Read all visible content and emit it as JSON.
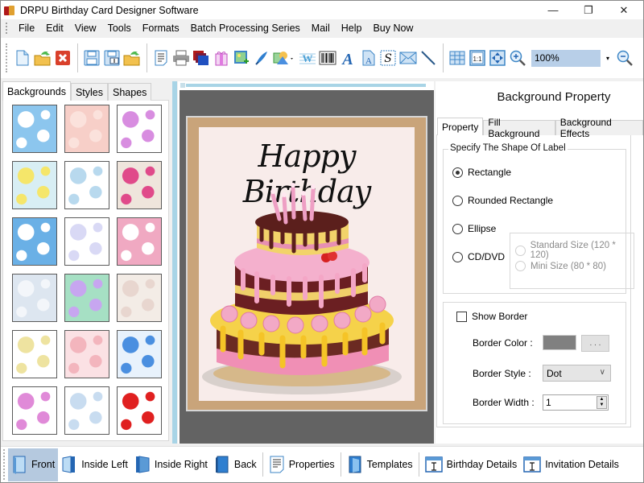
{
  "window": {
    "title": "DRPU Birthday Card Designer Software",
    "minimize_glyph": "—",
    "maximize_glyph": "❐",
    "close_glyph": "✕"
  },
  "menu": [
    "File",
    "Edit",
    "View",
    "Tools",
    "Formats",
    "Batch Processing Series",
    "Mail",
    "Help",
    "Buy Now"
  ],
  "toolbar": {
    "zoom_value": "100%",
    "zoom_dropdown_glyph": "▾",
    "buttons": [
      {
        "name": "new",
        "icon": "new-document-icon"
      },
      {
        "name": "open",
        "icon": "open-folder-icon"
      },
      {
        "name": "close",
        "icon": "close-icon"
      },
      {
        "name": "save",
        "icon": "save-icon"
      },
      {
        "name": "save-as",
        "icon": "save-as-icon"
      },
      {
        "name": "export",
        "icon": "export-folder-icon"
      },
      {
        "name": "print-preview",
        "icon": "print-preview-icon"
      },
      {
        "name": "print",
        "icon": "printer-icon"
      },
      {
        "name": "batch-copy",
        "icon": "copy-layers-icon"
      },
      {
        "name": "gift",
        "icon": "gift-icon"
      },
      {
        "name": "insert-image",
        "icon": "insert-image-icon"
      },
      {
        "name": "pen",
        "icon": "pen-icon"
      },
      {
        "name": "shapes",
        "icon": "shapes-icon"
      },
      {
        "name": "watermark",
        "icon": "watermark-icon"
      },
      {
        "name": "barcode",
        "icon": "barcode-icon"
      },
      {
        "name": "text",
        "icon": "text-icon"
      },
      {
        "name": "text-document",
        "icon": "text-document-icon"
      },
      {
        "name": "signature",
        "icon": "signature-icon"
      },
      {
        "name": "mail",
        "icon": "mail-icon"
      },
      {
        "name": "line",
        "icon": "line-icon"
      },
      {
        "name": "grid",
        "icon": "grid-icon"
      },
      {
        "name": "actual-size",
        "icon": "actual-size-icon",
        "label": "1:1"
      },
      {
        "name": "fit-window",
        "icon": "fit-window-icon"
      },
      {
        "name": "zoom-in",
        "icon": "zoom-in-icon"
      },
      {
        "name": "zoom-out",
        "icon": "zoom-out-icon"
      }
    ]
  },
  "left_panel": {
    "tabs": [
      {
        "label": "Backgrounds",
        "active": true
      },
      {
        "label": "Styles",
        "active": false
      },
      {
        "label": "Shapes",
        "active": false
      }
    ],
    "thumbnails": [
      {
        "name": "clouds",
        "colors": [
          "#8cc6ee",
          "#ffffff"
        ]
      },
      {
        "name": "pink-floral",
        "colors": [
          "#f7cfc8",
          "#fbe2dc"
        ]
      },
      {
        "name": "butterflies",
        "colors": [
          "#ffffff",
          "#d88de0"
        ]
      },
      {
        "name": "daisies",
        "colors": [
          "#d8eef4",
          "#f5e66a"
        ]
      },
      {
        "name": "pastel-scene",
        "colors": [
          "#ffffff",
          "#b8d9ee"
        ]
      },
      {
        "name": "balloons-beige",
        "colors": [
          "#efe5dc",
          "#e04a8a"
        ]
      },
      {
        "name": "stars-blue",
        "colors": [
          "#6ab0e6",
          "#ffffff"
        ]
      },
      {
        "name": "balloon-sketch",
        "colors": [
          "#ffffff",
          "#d9d9f5"
        ]
      },
      {
        "name": "pink-cake",
        "colors": [
          "#f0a9c2",
          "#ffffff"
        ]
      },
      {
        "name": "bubbles",
        "colors": [
          "#dde6f0",
          "#f3f6fa"
        ]
      },
      {
        "name": "rainbow",
        "colors": [
          "#a6e0c4",
          "#c7a6f0"
        ]
      },
      {
        "name": "teddy",
        "colors": [
          "#f3ece6",
          "#e8d6cf"
        ]
      },
      {
        "name": "happy-birthday-text",
        "colors": [
          "#ffffff",
          "#eee3a0"
        ]
      },
      {
        "name": "pink-hearts-stripe",
        "colors": [
          "#fbe1e4",
          "#f3b5bd"
        ]
      },
      {
        "name": "colorful-balloons",
        "colors": [
          "#e8f2fc",
          "#4a8fe0"
        ]
      },
      {
        "name": "heart-outlines",
        "colors": [
          "#ffffff",
          "#e08ad8"
        ]
      },
      {
        "name": "balloon-bunches",
        "colors": [
          "#ffffff",
          "#c8dcf0"
        ]
      },
      {
        "name": "red-hearts",
        "colors": [
          "#ffffff",
          "#e02020"
        ]
      }
    ]
  },
  "canvas": {
    "card_text": "Happy Birthday",
    "stage_color": "#636363",
    "frame_color": "#c9a47a",
    "paper_color": "#f8ecea"
  },
  "right_panel": {
    "title": "Background Property",
    "tabs": [
      {
        "label": "Property",
        "active": true
      },
      {
        "label": "Fill Background",
        "active": false
      },
      {
        "label": "Background Effects",
        "active": false
      }
    ],
    "shape_group_title": "Specify The Shape Of Label",
    "shapes": [
      {
        "label": "Rectangle",
        "checked": true
      },
      {
        "label": "Rounded Rectangle",
        "checked": false
      },
      {
        "label": "Ellipse",
        "checked": false
      },
      {
        "label": "CD/DVD",
        "checked": false
      }
    ],
    "cd_sizes": [
      {
        "label": "Standard Size (120 * 120)",
        "enabled": false
      },
      {
        "label": "Mini Size (80 * 80)",
        "enabled": false
      }
    ],
    "show_border_label": "Show Border",
    "show_border_checked": false,
    "border_color_label": "Border Color :",
    "border_color_value": "#808080",
    "border_color_button": ". . .",
    "border_style_label": "Border Style :",
    "border_style_value": "Dot",
    "border_width_label": "Border Width :",
    "border_width_value": "1"
  },
  "bottom_bar": [
    {
      "label": "Front",
      "icon": "front-page-icon",
      "active": true
    },
    {
      "label": "Inside Left",
      "icon": "inside-left-page-icon",
      "active": false
    },
    {
      "label": "Inside Right",
      "icon": "inside-right-page-icon",
      "active": false
    },
    {
      "label": "Back",
      "icon": "back-page-icon",
      "active": false
    },
    {
      "label": "Properties",
      "icon": "properties-icon",
      "active": false
    },
    {
      "label": "Templates",
      "icon": "templates-icon",
      "active": false
    },
    {
      "label": "Birthday Details",
      "icon": "birthday-details-icon",
      "active": false
    },
    {
      "label": "Invitation Details",
      "icon": "invitation-details-icon",
      "active": false
    }
  ]
}
